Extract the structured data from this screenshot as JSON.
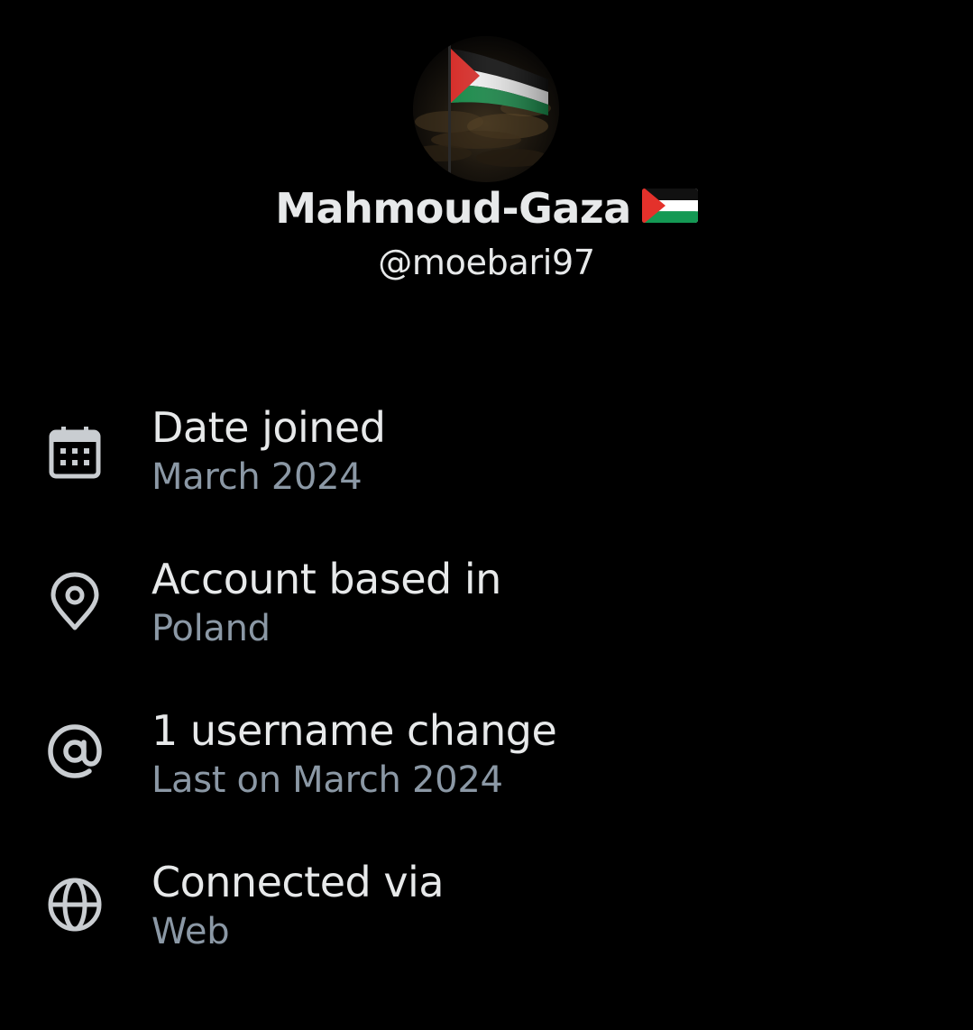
{
  "profile": {
    "display_name": "Mahmoud-Gaza",
    "name_emoji": "palestine-flag-emoji",
    "handle": "@moebari97",
    "avatar": "palestine-flag-avatar"
  },
  "info": [
    {
      "icon": "calendar-icon",
      "title": "Date joined",
      "value": "March 2024"
    },
    {
      "icon": "location-pin-icon",
      "title": "Account based in",
      "value": "Poland"
    },
    {
      "icon": "at-sign-icon",
      "title": "1 username change",
      "value": "Last on March 2024"
    },
    {
      "icon": "globe-icon",
      "title": "Connected via",
      "value": "Web"
    }
  ],
  "colors": {
    "background": "#000000",
    "primary_text": "#e7e9ea",
    "secondary_text": "#8b98a5",
    "flag_black": "#000000",
    "flag_white": "#ffffff",
    "flag_green": "#149954",
    "flag_red": "#e4312b"
  }
}
